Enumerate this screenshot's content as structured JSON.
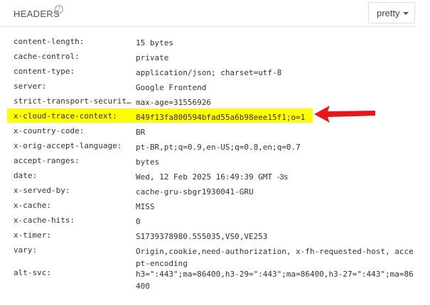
{
  "header": {
    "title": "HEADERS",
    "help_icon": "question-circle-icon",
    "format_button": "pretty"
  },
  "rows": [
    {
      "key": "content-length:",
      "value": "15 bytes"
    },
    {
      "key": "cache-control:",
      "value": "private"
    },
    {
      "key": "content-type:",
      "value": "application/json; charset=utf-8"
    },
    {
      "key": "server:",
      "value": "Google Frontend"
    },
    {
      "key": "strict-transport-security:",
      "value": "max-age=31556926"
    },
    {
      "key": "x-cloud-trace-context:",
      "value": "849f13fa800594bfad55a6b98eee15f1;o=1"
    },
    {
      "key": "x-country-code:",
      "value": "BR"
    },
    {
      "key": "x-orig-accept-language:",
      "value": "pt-BR,pt;q=0.9,en-US;q=0.8,en;q=0.7"
    },
    {
      "key": "accept-ranges:",
      "value": "bytes"
    },
    {
      "key": "date:",
      "value": "Wed, 12 Feb 2025 16:49:39 GMT",
      "suffix": "-3s"
    },
    {
      "key": "x-served-by:",
      "value": "cache-gru-sbgr1930041-GRU"
    },
    {
      "key": "x-cache:",
      "value": "MISS"
    },
    {
      "key": "x-cache-hits:",
      "value": "0"
    },
    {
      "key": "x-timer:",
      "value": "S1739378980.555035,VS0,VE253"
    },
    {
      "key": "vary:",
      "value": "Origin,cookie,need-authorization, x-fh-requested-host, accept-encoding"
    },
    {
      "key": "alt-svc:",
      "value": "h3=\":443\";ma=86400,h3-29=\":443\";ma=86400,h3-27=\":443\";ma=86400"
    }
  ],
  "colors": {
    "highlight": "#ffff00",
    "arrow": "#e8151b"
  },
  "annotation": {
    "arrow_icon": "red-arrow-icon"
  }
}
